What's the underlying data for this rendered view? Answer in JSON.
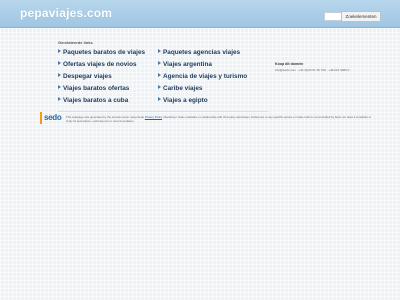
{
  "header": {
    "domain": "pepaviajes.com",
    "search_button": "Zoekelementen"
  },
  "related": {
    "title": "Gerelateerde links",
    "links": [
      "Paquetes baratos de viajes",
      "Paquetes agencias viajes",
      "Ofertas viajes de novios",
      "Viajes argentina",
      "Despegar viajes",
      "Agencia de viajes y turismo",
      "Viajes baratos ofertas",
      "Caribe viajes",
      "Viajes baratos a cuba",
      "Viajes a egipto"
    ]
  },
  "side": {
    "title": "Koop dit domein",
    "text": "info@sedo.com · +31 (0)20 51 36 700 · +49 221 3480 0"
  },
  "sedo": {
    "logo_text": "sedo"
  },
  "footer": {
    "text_before": "This webpage was generated by the domain owner using Sedo",
    "privacy_label": "Privacy Policy",
    "text_after": ". Disclaimer: Sedo maintains no relationship with third party advertisers. Reference to any specific service or trade mark is not controlled by Sedo nor does it constitute or imply its association, endorsement or recommendation."
  }
}
